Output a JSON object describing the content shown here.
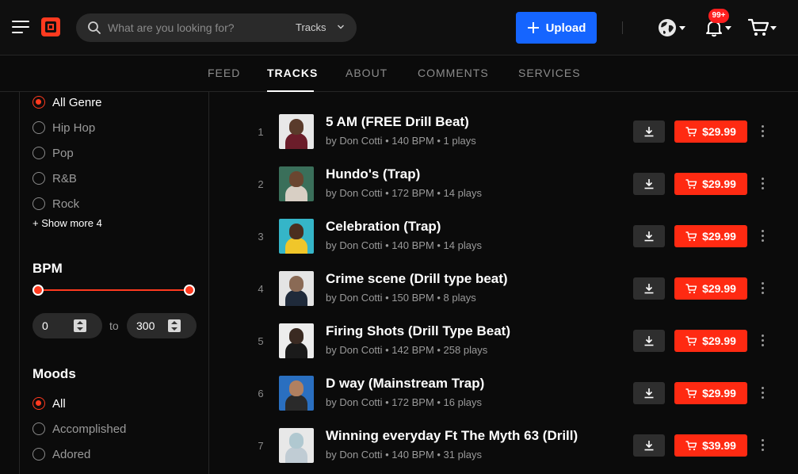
{
  "header": {
    "search_placeholder": "What are you looking for?",
    "search_scope": "Tracks",
    "upload_label": "Upload",
    "notifications_badge": "99+"
  },
  "tabs": [
    {
      "label": "FEED",
      "active": false
    },
    {
      "label": "TRACKS",
      "active": true
    },
    {
      "label": "ABOUT",
      "active": false
    },
    {
      "label": "COMMENTS",
      "active": false
    },
    {
      "label": "SERVICES",
      "active": false
    }
  ],
  "sidebar": {
    "genres": [
      {
        "label": "All Genre",
        "checked": true
      },
      {
        "label": "Hip Hop",
        "checked": false
      },
      {
        "label": "Pop",
        "checked": false
      },
      {
        "label": "R&B",
        "checked": false
      },
      {
        "label": "Rock",
        "checked": false
      }
    ],
    "show_more": "+ Show more 4",
    "bpm_title": "BPM",
    "bpm_min": "0",
    "bpm_max": "300",
    "bpm_to": "to",
    "moods_title": "Moods",
    "moods": [
      {
        "label": "All",
        "checked": true
      },
      {
        "label": "Accomplished",
        "checked": false
      },
      {
        "label": "Adored",
        "checked": false
      }
    ]
  },
  "tracks": [
    {
      "num": "1",
      "title": "5 AM (FREE Drill Beat)",
      "meta": "by Don Cotti • 140 BPM • 1 plays",
      "price": "$29.99",
      "thumb_bg": "#e8e8e8",
      "thumb_face": "#5a3b2b",
      "thumb_body": "#6b1d2a"
    },
    {
      "num": "2",
      "title": "Hundo's (Trap)",
      "meta": "by Don Cotti • 172 BPM • 14 plays",
      "price": "$29.99",
      "thumb_bg": "#3a6f5a",
      "thumb_face": "#6a4630",
      "thumb_body": "#d8cfc4"
    },
    {
      "num": "3",
      "title": "Celebration (Trap)",
      "meta": "by Don Cotti • 140 BPM • 14 plays",
      "price": "$29.99",
      "thumb_bg": "#35b5c8",
      "thumb_face": "#4a2e1f",
      "thumb_body": "#f0c62a"
    },
    {
      "num": "4",
      "title": "Crime scene (Drill type beat)",
      "meta": "by Don Cotti • 150 BPM • 8 plays",
      "price": "$29.99",
      "thumb_bg": "#e4e4e4",
      "thumb_face": "#8a6a55",
      "thumb_body": "#1f2a3a"
    },
    {
      "num": "5",
      "title": "Firing Shots (Drill Type Beat)",
      "meta": "by Don Cotti • 142 BPM • 258 plays",
      "price": "$29.99",
      "thumb_bg": "#ededed",
      "thumb_face": "#3a2a22",
      "thumb_body": "#1a1a1a"
    },
    {
      "num": "6",
      "title": "D way (Mainstream Trap)",
      "meta": "by Don Cotti • 172 BPM • 16 plays",
      "price": "$29.99",
      "thumb_bg": "#2a6fc0",
      "thumb_face": "#b08060",
      "thumb_body": "#2a2a2a"
    },
    {
      "num": "7",
      "title": "Winning everyday Ft The Myth 63 (Drill)",
      "meta": "by Don Cotti • 140 BPM • 31 plays",
      "price": "$39.99",
      "thumb_bg": "#e8e8e8",
      "thumb_face": "#b0c8d0",
      "thumb_body": "#c0ccd4"
    }
  ],
  "colors": {
    "accent": "#ff2a12",
    "upload": "#1565ff",
    "background": "#0b0b0b"
  },
  "icons": [
    "menu-icon",
    "logo-icon",
    "search-icon",
    "chevron-down-icon",
    "plus-icon",
    "globe-icon",
    "bell-icon",
    "cart-icon",
    "download-icon",
    "more-vertical-icon"
  ]
}
